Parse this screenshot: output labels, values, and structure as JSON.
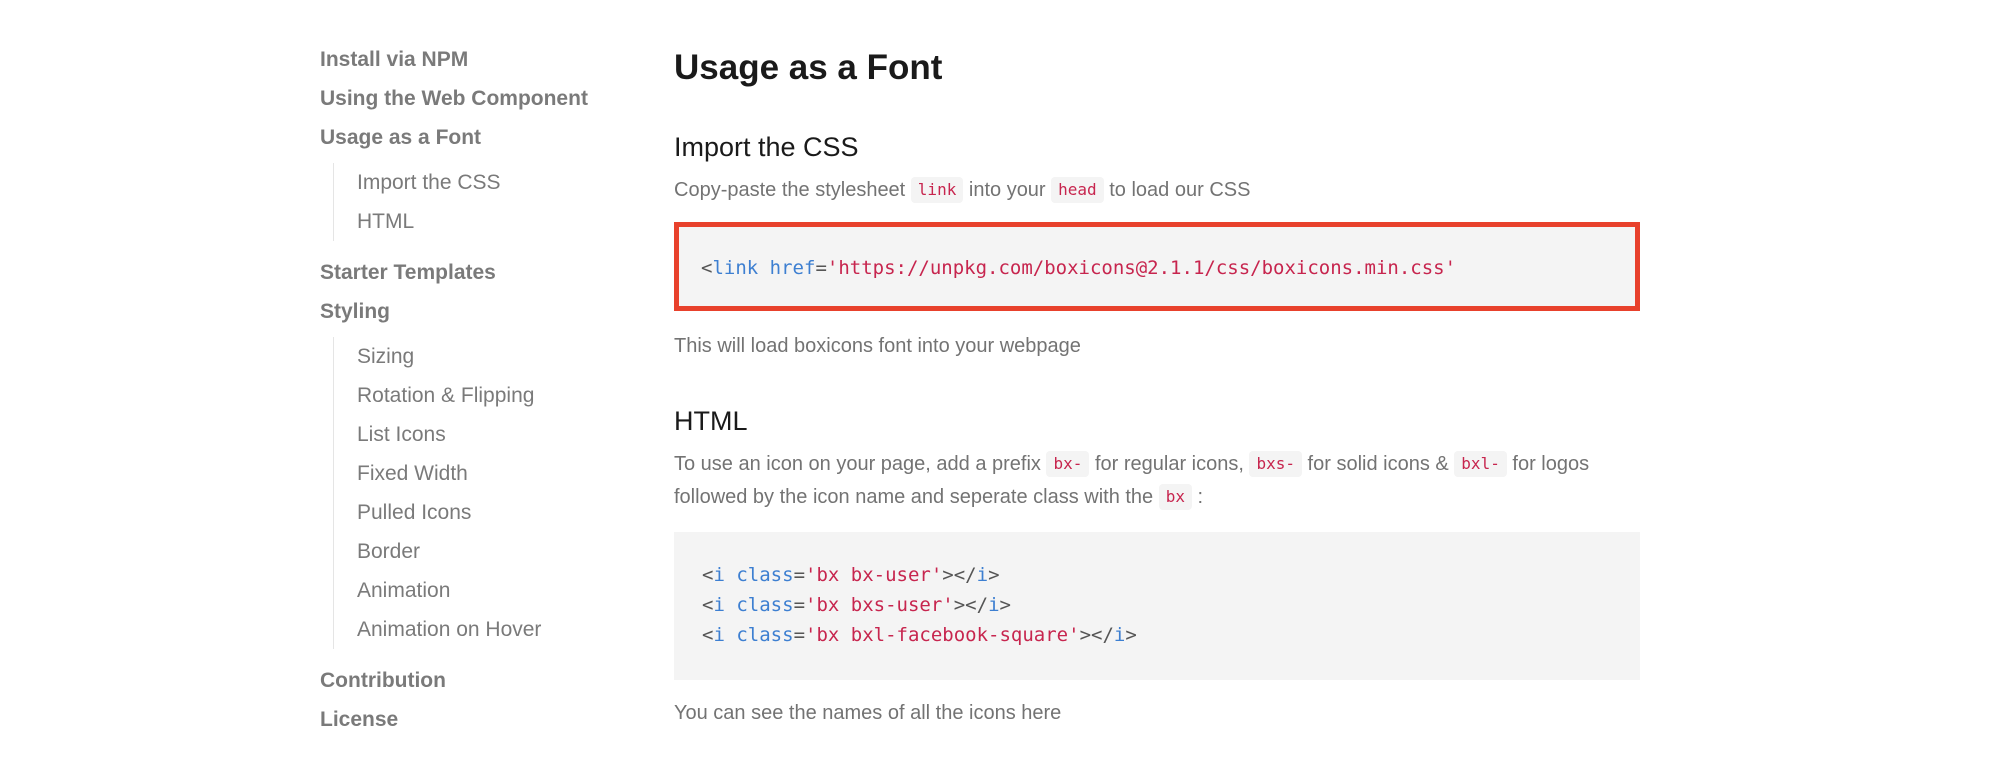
{
  "colors": {
    "highlight_border": "#e8412c",
    "code_string": "#c7254e",
    "code_keyword": "#3d7fd1",
    "muted_text": "#737373",
    "code_bg": "#f4f4f4"
  },
  "sidebar": {
    "items": [
      {
        "label": "Install via NPM"
      },
      {
        "label": "Using the Web Component"
      },
      {
        "label": "Usage as a Font"
      }
    ],
    "font_sub": [
      {
        "label": "Import the CSS"
      },
      {
        "label": "HTML"
      }
    ],
    "items_mid": [
      {
        "label": "Starter Templates"
      },
      {
        "label": "Styling"
      }
    ],
    "styling_sub": [
      {
        "label": "Sizing"
      },
      {
        "label": "Rotation & Flipping"
      },
      {
        "label": "List Icons"
      },
      {
        "label": "Fixed Width"
      },
      {
        "label": "Pulled Icons"
      },
      {
        "label": "Border"
      },
      {
        "label": "Animation"
      },
      {
        "label": "Animation on Hover"
      }
    ],
    "items_bottom": [
      {
        "label": "Contribution"
      },
      {
        "label": "License"
      }
    ]
  },
  "main": {
    "title": "Usage as a Font",
    "import_section": {
      "title": "Import the CSS",
      "desc_1": "Copy-paste the stylesheet ",
      "code_link": "link",
      "desc_2": " into your ",
      "code_head": "head",
      "desc_3": " to load our CSS",
      "code": {
        "open": "<",
        "tag": "link",
        "attr": "href",
        "eq": "=",
        "value": "'https://unpkg.com/boxicons@2.1.1/css/boxicons.min.css'"
      },
      "after": "This will load boxicons font into your webpage"
    },
    "html_section": {
      "title": "HTML",
      "line1_a": "To use an icon on your page, add a prefix ",
      "code_bx_prefix": "bx-",
      "line1_b": " for regular icons, ",
      "code_bxs_prefix": "bxs-",
      "line1_c": " for solid icons & ",
      "code_bxl_prefix": "bxl-",
      "line1_d": " for logos",
      "line2_a": "followed by the icon name and seperate class with the ",
      "code_bx": "bx",
      "line2_b": " :",
      "code_lines": [
        {
          "open": "<",
          "tag": "i",
          "attr": "class",
          "eq": "=",
          "value": "'bx bx-user'",
          "mid": "></",
          "close_tag": "i",
          "end": ">"
        },
        {
          "open": "<",
          "tag": "i",
          "attr": "class",
          "eq": "=",
          "value": "'bx bxs-user'",
          "mid": "></",
          "close_tag": "i",
          "end": ">"
        },
        {
          "open": "<",
          "tag": "i",
          "attr": "class",
          "eq": "=",
          "value": "'bx bxl-facebook-square'",
          "mid": "></",
          "close_tag": "i",
          "end": ">"
        }
      ],
      "after": "You can see the names of all the icons here"
    }
  }
}
